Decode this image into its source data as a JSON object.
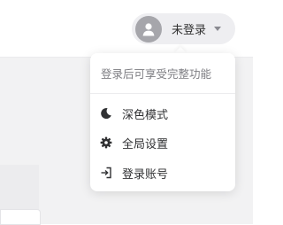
{
  "header": {
    "user_status": "未登录"
  },
  "dropdown": {
    "hint": "登录后可享受完整功能",
    "items": [
      {
        "label": "深色模式",
        "icon": "moon-icon"
      },
      {
        "label": "全局设置",
        "icon": "gear-icon"
      },
      {
        "label": "登录账号",
        "icon": "login-icon"
      }
    ]
  },
  "colors": {
    "avatar_bg": "#a6a6ab",
    "pill_bg": "#eeeef1",
    "text": "#303133",
    "muted": "#7d7d82"
  }
}
